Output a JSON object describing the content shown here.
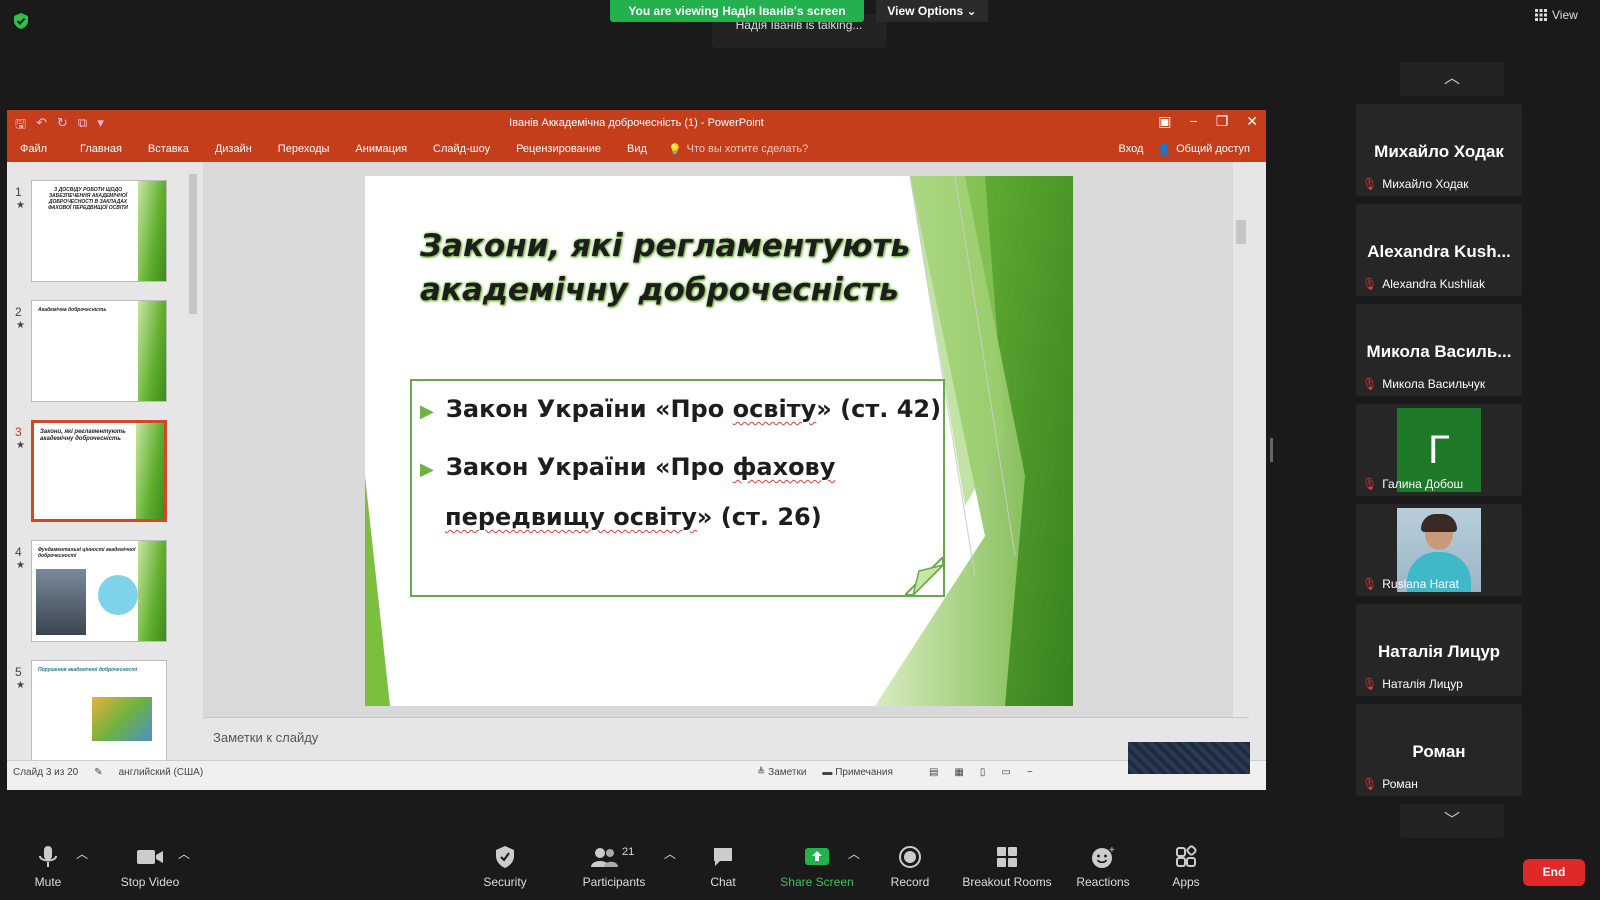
{
  "banner": {
    "viewing": "You are viewing Надія Іванів's screen",
    "view_options": "View Options",
    "talking": "Надія Іванів is talking...",
    "view": "View"
  },
  "ppt": {
    "title": "Іванів Аккадемічна доброчесність (1)  -  PowerPoint",
    "tabs": [
      "Файл",
      "Главная",
      "Вставка",
      "Дизайн",
      "Переходы",
      "Анимация",
      "Слайд-шоу",
      "Рецензирование",
      "Вид"
    ],
    "tell_me": "Что вы хотите сделать?",
    "login": "Вход",
    "share": "Общий доступ",
    "thumbs": [
      {
        "num": "1",
        "text": "З ДОСВІДУ РОБОТИ ЩОДО ЗАБЕЗПЕЧЕННЯ АКАДЕМІЧНОЇ ДОБРОЧЕСНОСТІ В ЗАКЛАДАХ ФАХОВОЇ ПЕРЕДВИЩОЇ ОСВІТИ"
      },
      {
        "num": "2",
        "text": "Академічна доброчесність"
      },
      {
        "num": "3",
        "text": "Закони, які регламентують академічну доброчесність"
      },
      {
        "num": "4",
        "text": "Фундаментальні цінності академічної доброчесності"
      },
      {
        "num": "5",
        "text": "Порушення академічної доброчесності"
      }
    ],
    "slide": {
      "title": "Закони, які регламентують академічну доброчесність",
      "bullet1_pre": "Закон України «Про ",
      "bullet1_wavy": "освіту",
      "bullet1_post": "» (ст. 42)",
      "bullet2_pre": "Закон України «Про ",
      "bullet2_wavy": "фахову",
      "bullet3_wavy": "передвищу освіту",
      "bullet3_post": "» (ст. 26)"
    },
    "notes_placeholder": "Заметки к слайду",
    "status": {
      "slide_of": "Слайд 3 из 20",
      "language": "английский (США)",
      "notes": "Заметки",
      "comments": "Примечания"
    }
  },
  "participants": [
    {
      "name": "Михайло Ходак",
      "label": "Михайло Ходак",
      "type": "name"
    },
    {
      "name": "Alexandra Kush...",
      "label": "Alexandra Kushliak",
      "type": "name"
    },
    {
      "name": "Микола Василь...",
      "label": "Микола Васильчук",
      "type": "name"
    },
    {
      "initial": "Г",
      "label": "Галина Добош",
      "type": "avatar"
    },
    {
      "label": "Ruslana Harat",
      "type": "photo"
    },
    {
      "name": "Наталія Лицур",
      "label": "Наталія Лицур",
      "type": "name"
    },
    {
      "name": "Роман",
      "label": "Роман",
      "type": "name"
    }
  ],
  "toolbar": {
    "mute": "Mute",
    "stop_video": "Stop Video",
    "security": "Security",
    "participants": "Participants",
    "participants_count": "21",
    "chat": "Chat",
    "share_screen": "Share Screen",
    "record": "Record",
    "breakout_rooms": "Breakout Rooms",
    "reactions": "Reactions",
    "apps": "Apps",
    "end": "End"
  },
  "colors": {
    "banner_green": "#23b14d",
    "ppt_red": "#c43e1c",
    "end_red": "#e02828"
  }
}
